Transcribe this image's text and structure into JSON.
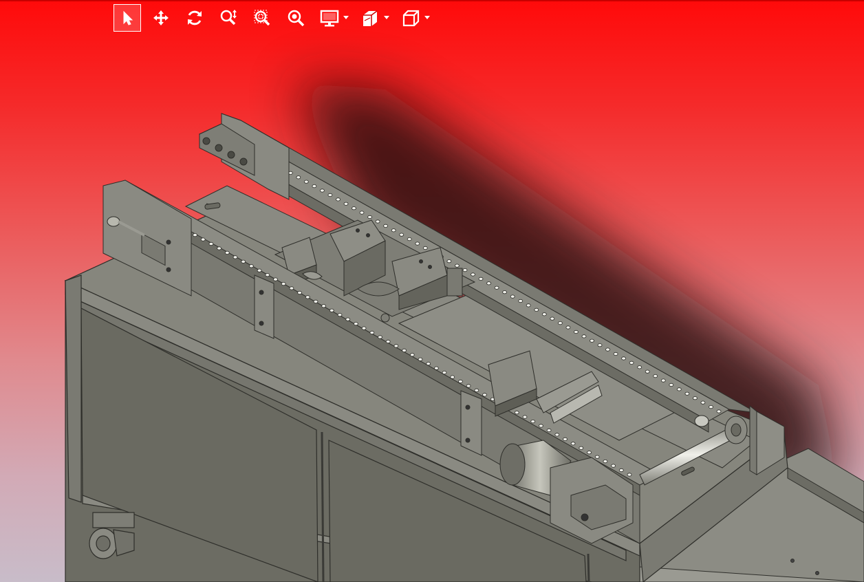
{
  "app": {
    "viewport_name": "3D model viewer",
    "background_gradient": [
      "#ff0a0a",
      "#c8bcc9"
    ],
    "model_color": "#7e7e74"
  },
  "toolbar": {
    "buttons": [
      {
        "id": "select",
        "icon": "select-arrow-icon",
        "active": true
      },
      {
        "id": "pan",
        "icon": "pan-move-icon",
        "active": false
      },
      {
        "id": "rotate",
        "icon": "rotate-icon",
        "active": false
      },
      {
        "id": "zoom-dynamic",
        "icon": "zoom-dynamic-icon",
        "active": false
      },
      {
        "id": "zoom-window",
        "icon": "zoom-window-icon",
        "active": false
      },
      {
        "id": "zoom-fit",
        "icon": "zoom-fit-icon",
        "active": false
      },
      {
        "id": "display-mode",
        "icon": "display-monitor-icon",
        "dropdown": true
      },
      {
        "id": "section-view",
        "icon": "section-view-icon",
        "dropdown": true
      },
      {
        "id": "view-orientation",
        "icon": "view-cube-icon",
        "dropdown": true
      }
    ]
  }
}
